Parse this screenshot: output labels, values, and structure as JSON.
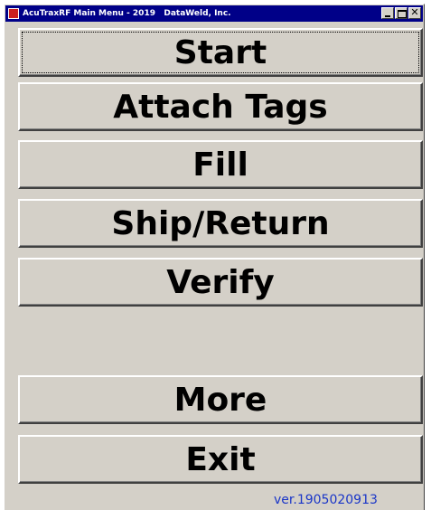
{
  "window": {
    "title": "AcuTraxRF Main Menu - 2019   DataWeld, Inc.",
    "close_glyph": "✕"
  },
  "menu": {
    "buttons": [
      {
        "label": "Start"
      },
      {
        "label": "Attach Tags"
      },
      {
        "label": "Fill"
      },
      {
        "label": "Ship/Return"
      },
      {
        "label": "Verify"
      },
      {
        "label": "More"
      },
      {
        "label": "Exit"
      }
    ]
  },
  "footer": {
    "version": "ver.1905020913"
  },
  "colors": {
    "titlebar": "#000088",
    "window_bg": "#d4d0c8",
    "version_text": "#1a36c8"
  }
}
